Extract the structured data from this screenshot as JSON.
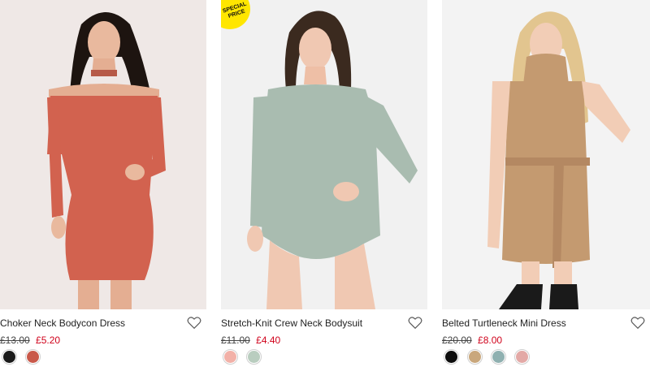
{
  "products": [
    {
      "name": "Choker Neck Bodycon Dress",
      "old_price": "£13.00",
      "new_price": "£5.20",
      "swatches": [
        "#1a1a1a",
        "#c9594a"
      ],
      "bg": "#efe8e6",
      "garment": "#d2624f"
    },
    {
      "name": "Stretch-Knit Crew Neck Bodysuit",
      "old_price": "£11.00",
      "new_price": "£4.40",
      "badge": "SPECIAL PRICE",
      "swatches": [
        "#f2b1a8",
        "#b9cdbf"
      ],
      "bg": "#f1f1f1",
      "garment": "#a9bcb0"
    },
    {
      "name": "Belted Turtleneck Mini Dress",
      "old_price": "£20.00",
      "new_price": "£8.00",
      "swatches": [
        "#0d0d0d",
        "#c9a77c",
        "#8fb0b0",
        "#e3a9a6"
      ],
      "bg": "#f3f3f3",
      "garment": "#c49a70"
    }
  ]
}
